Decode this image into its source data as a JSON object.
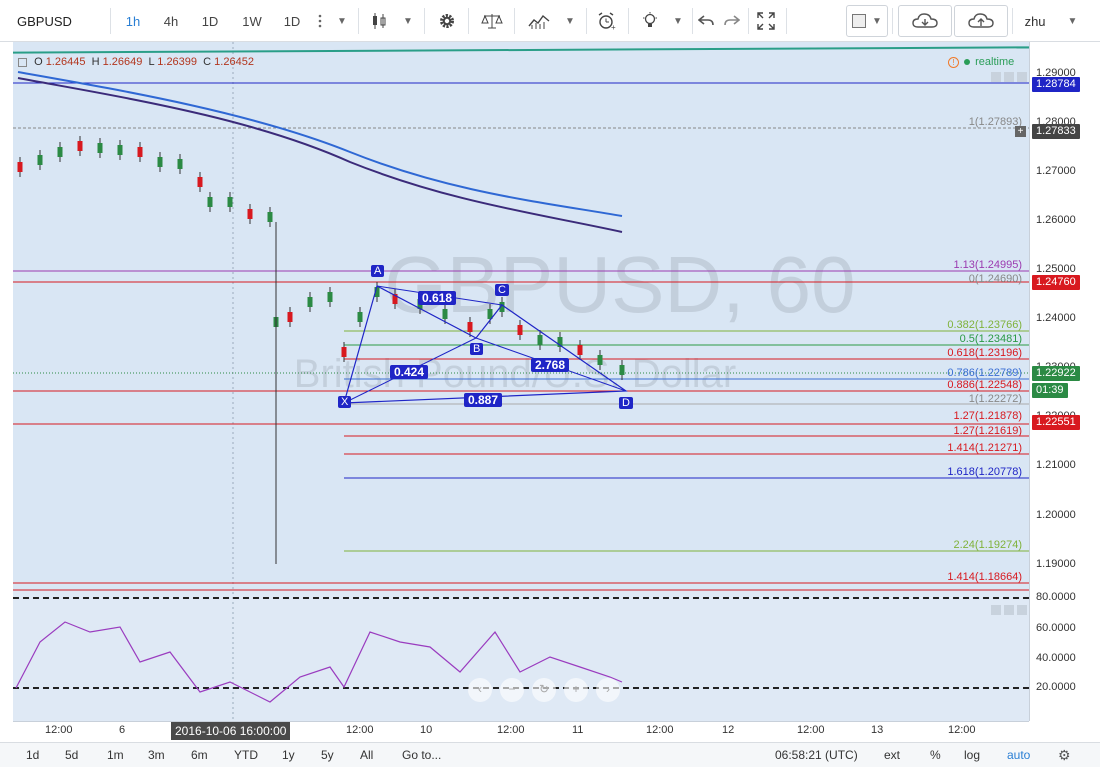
{
  "toolbar": {
    "symbol": "GBPUSD",
    "intervals": [
      "1h",
      "4h",
      "1D",
      "1W",
      "1D"
    ],
    "selected_interval": "1h",
    "user": "zhu"
  },
  "legend": {
    "o_label": "O",
    "o_value": "1.26445",
    "h_label": "H",
    "h_value": "1.26649",
    "l_label": "L",
    "l_value": "1.26399",
    "c_label": "C",
    "c_value": "1.26452"
  },
  "realtime_label": "realtime",
  "watermark": {
    "symbol": "GBPUSD, 60",
    "name": "British Pound/U.S. Dollar"
  },
  "price_axis": {
    "ticks": [
      "1.29000",
      "1.28000",
      "1.27000",
      "1.26000",
      "1.25000",
      "1.24000",
      "1.23000",
      "1.22000",
      "1.21000",
      "1.20000",
      "1.19000"
    ],
    "tags": [
      {
        "text": "1.28784",
        "color": "#1f25c6"
      },
      {
        "text": "1.27833",
        "color": "#444444"
      },
      {
        "text": "1.24760",
        "color": "#d8191f"
      },
      {
        "text": "1.22922",
        "color": "#2b8a44"
      },
      {
        "text": "01:39",
        "color": "#2b8a44"
      },
      {
        "text": "1.22551",
        "color": "#d8191f"
      }
    ]
  },
  "fib_labels": [
    {
      "text": "1(1.27893)",
      "color": "#888888"
    },
    {
      "text": "1.13(1.24995)",
      "color": "#9b3bb0"
    },
    {
      "text": "0(1.24690)",
      "color": "#888888"
    },
    {
      "text": "0.382(1.23766)",
      "color": "#7fb23a"
    },
    {
      "text": "0.5(1.23481)",
      "color": "#2b9a45"
    },
    {
      "text": "0.618(1.23196)",
      "color": "#d8191f"
    },
    {
      "text": "0.786(1.22789)",
      "color": "#3b6fd4"
    },
    {
      "text": "0.886(1.22548)",
      "color": "#d8191f"
    },
    {
      "text": "1(1.22272)",
      "color": "#888888"
    },
    {
      "text": "1.27(1.21878)",
      "color": "#d8191f"
    },
    {
      "text": "1.27(1.21619)",
      "color": "#d8191f"
    },
    {
      "text": "1.414(1.21271)",
      "color": "#d8191f"
    },
    {
      "text": "1.618(1.20778)",
      "color": "#1f25c6"
    },
    {
      "text": "2.24(1.19274)",
      "color": "#7fb23a"
    },
    {
      "text": "1.414(1.18664)",
      "color": "#d8191f"
    }
  ],
  "pattern": {
    "points": [
      "X",
      "A",
      "B",
      "C",
      "D"
    ],
    "ratios": [
      "0.618",
      "0.424",
      "2.768",
      "0.887"
    ]
  },
  "rsi_axis": {
    "ticks": [
      "80.0000",
      "60.0000",
      "40.0000",
      "20.0000"
    ]
  },
  "time_axis": {
    "ticks": [
      "12:00",
      "6",
      "12:00",
      "10",
      "12:00",
      "11",
      "12:00",
      "12",
      "12:00",
      "13",
      "12:00"
    ],
    "crosshair": "2016-10-06 16:00:00"
  },
  "bottombar": {
    "ranges": [
      "1d",
      "5d",
      "1m",
      "3m",
      "6m",
      "YTD",
      "1y",
      "5y",
      "All"
    ],
    "goto": "Go to...",
    "clock": "06:58:21 (UTC)",
    "options": [
      "ext",
      "%",
      "log",
      "auto"
    ]
  },
  "colors": {
    "accent": "#2a7fd4",
    "up": "#2b8a44",
    "down": "#d8191f",
    "plot_bg": "#d9e6f4"
  }
}
